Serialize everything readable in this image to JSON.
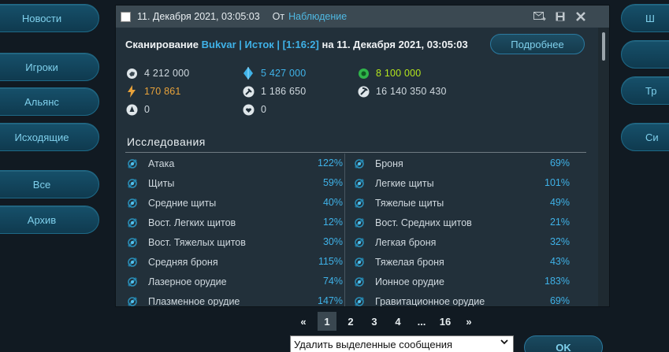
{
  "nav_left": [
    {
      "label": "Новости"
    },
    {
      "label": "Игроки"
    },
    {
      "label": "Альянс"
    },
    {
      "label": "Исходящие"
    },
    {
      "label": "Все"
    },
    {
      "label": "Архив"
    }
  ],
  "nav_right": [
    {
      "label": "Ш"
    },
    {
      "label": ""
    },
    {
      "label": "Тр"
    },
    {
      "label": "Си"
    }
  ],
  "message": {
    "date": "11. Декабря 2021, 03:05:03",
    "from_label": "От",
    "from_name": "Наблюдение",
    "scan_prefix": "Сканирование",
    "scan_target": "Bukvar | Исток | [1:16:2]",
    "scan_on": "на",
    "scan_date": "11. Декабря 2021, 03:05:03",
    "details_label": "Подробнее"
  },
  "resources": {
    "metal": "4 212 000",
    "crystal": "5 427 000",
    "deuterium": "8 100 000",
    "energy": "170 861",
    "r5": "1 186 650",
    "r6": "16 140 350 430",
    "r7": "0",
    "r8": "0"
  },
  "colors": {
    "accent": "#3fb2e8",
    "energy": "#e8a23a",
    "deuterium": "#b5e61d"
  },
  "research_title": "Исследования",
  "research_left": [
    {
      "name": "Атака",
      "pct": "122%"
    },
    {
      "name": "Щиты",
      "pct": "59%"
    },
    {
      "name": "Средние щиты",
      "pct": "40%"
    },
    {
      "name": "Вост. Легких щитов",
      "pct": "12%"
    },
    {
      "name": "Вост. Тяжелых щитов",
      "pct": "30%"
    },
    {
      "name": "Средняя броня",
      "pct": "115%"
    },
    {
      "name": "Лазерное орудие",
      "pct": "74%"
    },
    {
      "name": "Плазменное орудие",
      "pct": "147%"
    }
  ],
  "research_right": [
    {
      "name": "Броня",
      "pct": "69%"
    },
    {
      "name": "Легкие щиты",
      "pct": "101%"
    },
    {
      "name": "Тяжелые щиты",
      "pct": "49%"
    },
    {
      "name": "Вост. Средних щитов",
      "pct": "21%"
    },
    {
      "name": "Легкая броня",
      "pct": "32%"
    },
    {
      "name": "Тяжелая броня",
      "pct": "43%"
    },
    {
      "name": "Ионное орудие",
      "pct": "183%"
    },
    {
      "name": "Гравитационное орудие",
      "pct": "69%"
    }
  ],
  "pager": {
    "prev": "«",
    "pages": [
      "1",
      "2",
      "3",
      "4",
      "...",
      "16"
    ],
    "next": "»",
    "current": "1"
  },
  "actions": {
    "select_value": "Удалить выделенные сообщения",
    "ok_label": "OK"
  }
}
